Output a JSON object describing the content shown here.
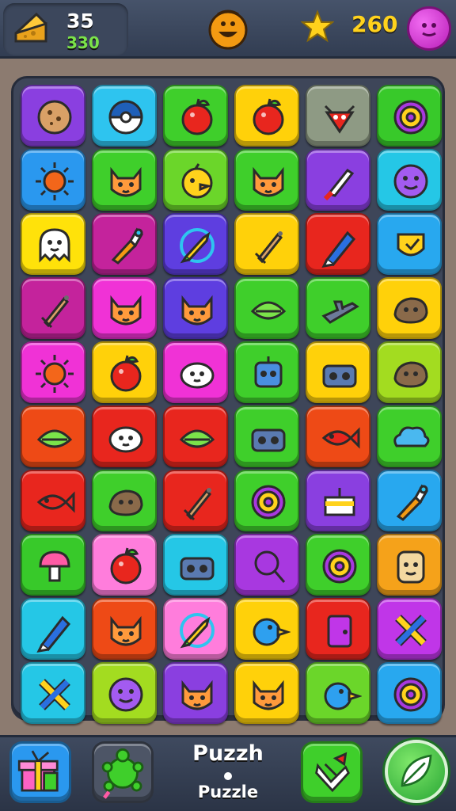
{
  "header": {
    "stat_top": "35",
    "stat_bottom": "330",
    "score": "260",
    "icons": {
      "stat": "cheese-wedge-icon",
      "coin": "orange-coin-face-icon",
      "star": "star-icon",
      "profile": "purple-face-icon"
    }
  },
  "board": {
    "rows": 10,
    "cols": 6,
    "tiles": [
      [
        {
          "color": "#8a3fe0",
          "icon": "cookie"
        },
        {
          "color": "#2ec4ef",
          "icon": "ball"
        },
        {
          "color": "#3fcf2b",
          "icon": "apple"
        },
        {
          "color": "#ffd10a",
          "icon": "apple"
        },
        {
          "color": "#8e9a84",
          "icon": "crab"
        },
        {
          "color": "#38c92a",
          "icon": "donut"
        }
      ],
      [
        {
          "color": "#2a98ef",
          "icon": "sun"
        },
        {
          "color": "#3fcf2b",
          "icon": "cat"
        },
        {
          "color": "#6bd62a",
          "icon": "chick"
        },
        {
          "color": "#3fcf2b",
          "icon": "cat"
        },
        {
          "color": "#8a3fe0",
          "icon": "knife"
        },
        {
          "color": "#25c7e6",
          "icon": "face"
        }
      ],
      [
        {
          "color": "#ffe20a",
          "icon": "ghost"
        },
        {
          "color": "#c4239c",
          "icon": "brush"
        },
        {
          "color": "#5e3ee0",
          "icon": "rocket"
        },
        {
          "color": "#ffd10a",
          "icon": "sword"
        },
        {
          "color": "#e8261e",
          "icon": "pencil"
        },
        {
          "color": "#28a8ef",
          "icon": "shield"
        }
      ],
      [
        {
          "color": "#c4239c",
          "icon": "sword"
        },
        {
          "color": "#f032d6",
          "icon": "cat"
        },
        {
          "color": "#5e3ee0",
          "icon": "cat"
        },
        {
          "color": "#3fcf2b",
          "icon": "leaf"
        },
        {
          "color": "#3fcf2b",
          "icon": "plane"
        },
        {
          "color": "#ffd10a",
          "icon": "rock"
        }
      ],
      [
        {
          "color": "#f032d6",
          "icon": "sun"
        },
        {
          "color": "#ffd10a",
          "icon": "apple"
        },
        {
          "color": "#f032d6",
          "icon": "sheep"
        },
        {
          "color": "#3fcf2b",
          "icon": "robot"
        },
        {
          "color": "#ffd10a",
          "icon": "radio"
        },
        {
          "color": "#a3dc20",
          "icon": "rock"
        }
      ],
      [
        {
          "color": "#ee4a16",
          "icon": "leaf"
        },
        {
          "color": "#e8261e",
          "icon": "sheep"
        },
        {
          "color": "#e8261e",
          "icon": "leaf"
        },
        {
          "color": "#3fcf2b",
          "icon": "radio"
        },
        {
          "color": "#ee4a16",
          "icon": "fish"
        },
        {
          "color": "#3fcf2b",
          "icon": "cloud"
        }
      ],
      [
        {
          "color": "#e8261e",
          "icon": "fish"
        },
        {
          "color": "#3fcf2b",
          "icon": "rock"
        },
        {
          "color": "#e8261e",
          "icon": "sword"
        },
        {
          "color": "#3fcf2b",
          "icon": "donut"
        },
        {
          "color": "#8a3fe0",
          "icon": "cake"
        },
        {
          "color": "#28a8ef",
          "icon": "brush"
        }
      ],
      [
        {
          "color": "#38c92a",
          "icon": "mushroom"
        },
        {
          "color": "#ff7ddc",
          "icon": "apple"
        },
        {
          "color": "#25c7e6",
          "icon": "radio"
        },
        {
          "color": "#a838e0",
          "icon": "balloon"
        },
        {
          "color": "#3fcf2b",
          "icon": "donut"
        },
        {
          "color": "#f5a21a",
          "icon": "toast"
        }
      ],
      [
        {
          "color": "#25c7e6",
          "icon": "pencil"
        },
        {
          "color": "#ee4a16",
          "icon": "cat"
        },
        {
          "color": "#ff7ddc",
          "icon": "rocket"
        },
        {
          "color": "#ffd10a",
          "icon": "bird"
        },
        {
          "color": "#e8261e",
          "icon": "door"
        },
        {
          "color": "#c036e8",
          "icon": "cross"
        }
      ],
      [
        {
          "color": "#25c7e6",
          "icon": "cross"
        },
        {
          "color": "#a3dc20",
          "icon": "face"
        },
        {
          "color": "#8a3fe0",
          "icon": "cat"
        },
        {
          "color": "#ffd10a",
          "icon": "cat"
        },
        {
          "color": "#6bd62a",
          "icon": "bird"
        },
        {
          "color": "#28a8ef",
          "icon": "donut"
        }
      ]
    ]
  },
  "footer": {
    "title": "Puzzh",
    "subtitle": "Puzzle",
    "buttons": [
      {
        "icon": "gift-box-icon",
        "color": "#2a98ef"
      },
      {
        "icon": "turtle-icon",
        "color": "#4d5566"
      },
      {
        "icon": "hint-hand-icon",
        "color": "#3fcf2b"
      },
      {
        "icon": "leaf-icon",
        "color": "#3fcf2b"
      }
    ]
  }
}
